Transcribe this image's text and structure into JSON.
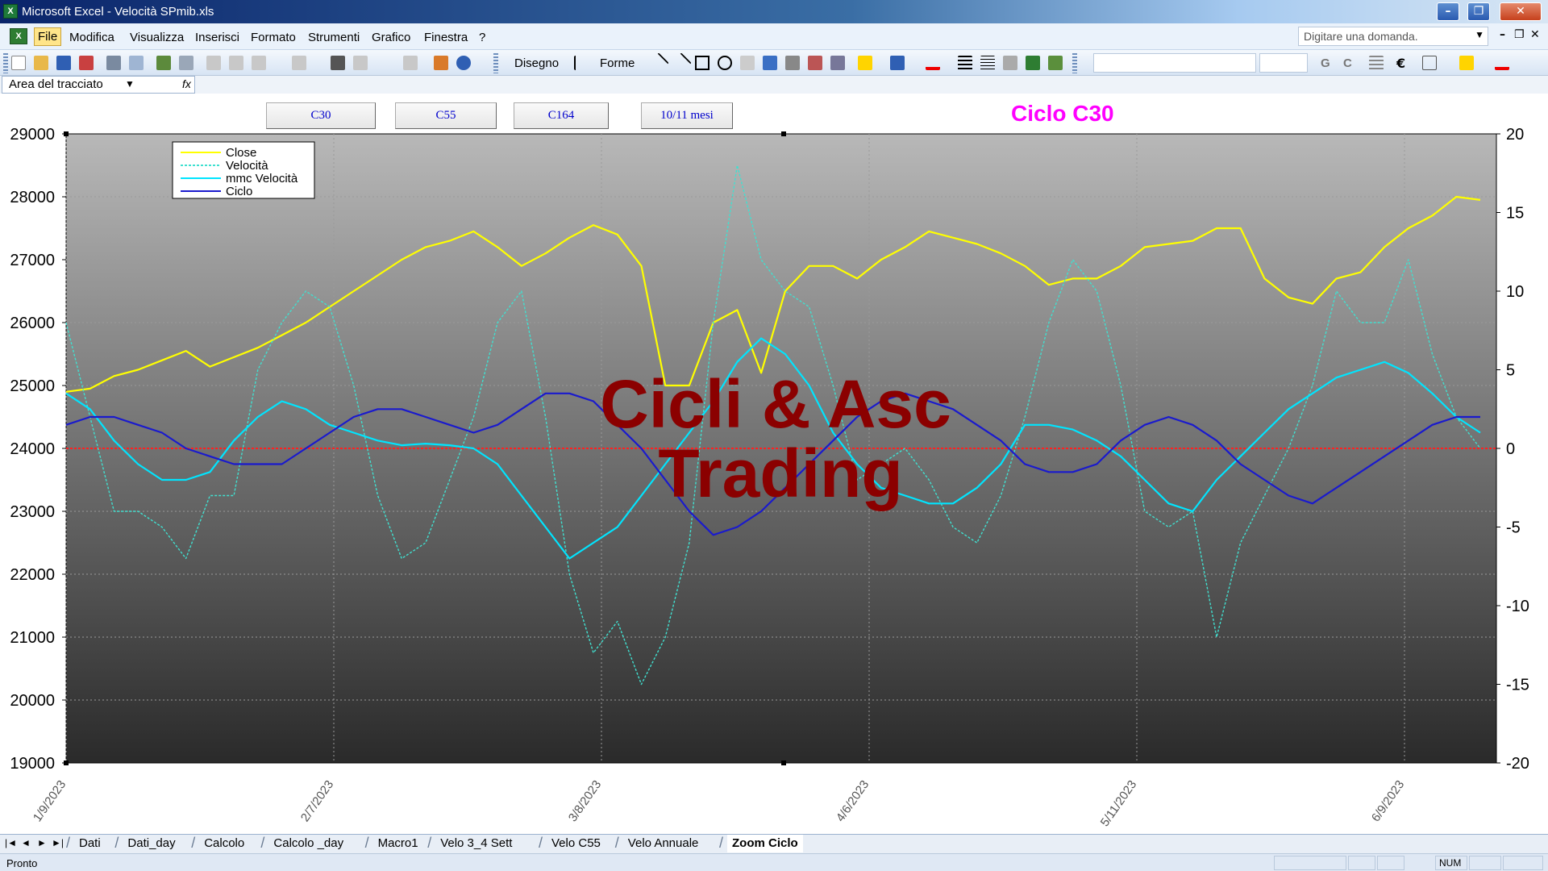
{
  "window": {
    "title": "Microsoft Excel - Velocità SPmib.xls",
    "app_icon": "X"
  },
  "menu": {
    "items": [
      "File",
      "Modifica",
      "Visualizza",
      "Inserisci",
      "Formato",
      "Strumenti",
      "Grafico",
      "Finestra",
      "?"
    ],
    "help_placeholder": "Digitare una domanda."
  },
  "toolbar": {
    "draw_label": "Disegno",
    "shapes_label": "Forme",
    "bold_label": "G",
    "italic_label": "C"
  },
  "name_box": {
    "value": "Area del tracciato",
    "fx": "fx"
  },
  "buttons": {
    "c30": "C30",
    "c55": "C55",
    "c164": "C164",
    "months": "10/11 mesi"
  },
  "chart_title": "Ciclo C30",
  "watermark": {
    "line1": "Cicli & Asc",
    "line2": "Trading"
  },
  "chart_data": {
    "type": "line",
    "title": "Ciclo C30",
    "y_left": {
      "min": 19000,
      "max": 29000,
      "step": 1000
    },
    "y_right": {
      "min": -20,
      "max": 20,
      "step": 5
    },
    "x_ticks": [
      "1/9/2023",
      "2/7/2023",
      "3/8/2023",
      "4/6/2023",
      "5/11/2023",
      "6/9/2023"
    ],
    "series": [
      {
        "name": "Close",
        "axis": "left",
        "color": "#ffff00",
        "values": [
          24900,
          24950,
          25150,
          25250,
          25400,
          25550,
          25300,
          25450,
          25600,
          25800,
          26000,
          26250,
          26500,
          26750,
          27000,
          27200,
          27300,
          27450,
          27200,
          26900,
          27100,
          27350,
          27550,
          27400,
          26900,
          25000,
          25000,
          26000,
          26200,
          25200,
          26500,
          26900,
          26900,
          26700,
          27000,
          27200,
          27450,
          27350,
          27250,
          27100,
          26900,
          26600,
          26700,
          26700,
          26900,
          27200,
          27250,
          27300,
          27500,
          27500,
          26700,
          26400,
          26300,
          26700,
          26800,
          27200,
          27500,
          27700,
          28000,
          27950
        ]
      },
      {
        "name": "Velocità",
        "axis": "right",
        "color": "#40e0d0",
        "dashed": true,
        "values": [
          8,
          2,
          -4,
          -4,
          -5,
          -7,
          -3,
          -3,
          5,
          8,
          10,
          9,
          4,
          -3,
          -7,
          -6,
          -2,
          2,
          8,
          10,
          2,
          -8,
          -13,
          -11,
          -15,
          -12,
          -6,
          8,
          18,
          12,
          10,
          9,
          4,
          -2,
          -1,
          0,
          -2,
          -5,
          -6,
          -3,
          2,
          8,
          12,
          10,
          4,
          -4,
          -5,
          -4,
          -12,
          -6,
          -3,
          0,
          4,
          10,
          8,
          8,
          12,
          6,
          2,
          0
        ]
      },
      {
        "name": "mmc Velocità",
        "axis": "right",
        "color": "#00e5ff",
        "values": [
          3.5,
          2.5,
          0.5,
          -1,
          -2,
          -2,
          -1.5,
          0.5,
          2,
          3,
          2.5,
          1.5,
          1,
          0.5,
          0.2,
          0.3,
          0.2,
          0,
          -1,
          -3,
          -5,
          -7,
          -6,
          -5,
          -3,
          -1,
          1,
          3,
          5.5,
          7,
          6,
          4,
          1,
          -1,
          -2.5,
          -3,
          -3.5,
          -3.5,
          -2.5,
          -1,
          1.5,
          1.5,
          1.2,
          0.5,
          -0.5,
          -2,
          -3.5,
          -4,
          -2,
          -0.5,
          1,
          2.5,
          3.5,
          4.5,
          5,
          5.5,
          4.8,
          3.5,
          2,
          1
        ]
      },
      {
        "name": "Ciclo",
        "axis": "right",
        "color": "#1a1acd",
        "values": [
          1.5,
          2,
          2,
          1.5,
          1,
          0,
          -0.5,
          -1,
          -1,
          -1,
          0,
          1,
          2,
          2.5,
          2.5,
          2,
          1.5,
          1,
          1.5,
          2.5,
          3.5,
          3.5,
          3,
          1.5,
          0,
          -2,
          -4,
          -5.5,
          -5,
          -4,
          -2.5,
          -1,
          0.5,
          2,
          3,
          3.5,
          3,
          2.5,
          1.5,
          0.5,
          -1,
          -1.5,
          -1.5,
          -1,
          0.5,
          1.5,
          2,
          1.5,
          0.5,
          -1,
          -2,
          -3,
          -3.5,
          -2.5,
          -1.5,
          -0.5,
          0.5,
          1.5,
          2,
          2
        ]
      }
    ],
    "legend_position": "top-left"
  },
  "sheet_tabs": [
    "Dati",
    "Dati_day",
    "Calcolo",
    "Calcolo _day",
    "Macro1",
    "Velo 3_4 Sett",
    "Velo C55",
    "Velo Annuale",
    "Zoom Ciclo"
  ],
  "active_tab": "Zoom Ciclo",
  "status": {
    "text": "Pronto",
    "num": "NUM"
  }
}
